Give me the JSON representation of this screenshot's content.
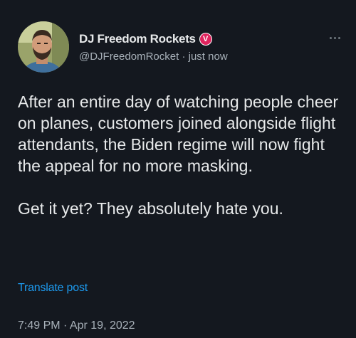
{
  "author": {
    "display_name": "DJ Freedom Rockets",
    "badge": "V",
    "handle": "@DJFreedomRocket",
    "separator": " · ",
    "time_ago": "just now"
  },
  "tweet": {
    "text": "After an entire day of watching people cheer on planes, customers joined alongside flight attendants, the Biden regime will now fight the appeal for no more masking.\n\nGet it yet? They absolutely hate you.",
    "translate_label": "Translate post",
    "timestamp": "7:49 PM · Apr 19, 2022"
  },
  "icons": {
    "more": "more-dots-icon",
    "badge": "verified-badge-icon"
  },
  "colors": {
    "background": "#14181f",
    "text": "#e7e9ea",
    "secondary": "#a7b0b8",
    "link": "#1d9bf0",
    "badge": "#e0245e"
  }
}
